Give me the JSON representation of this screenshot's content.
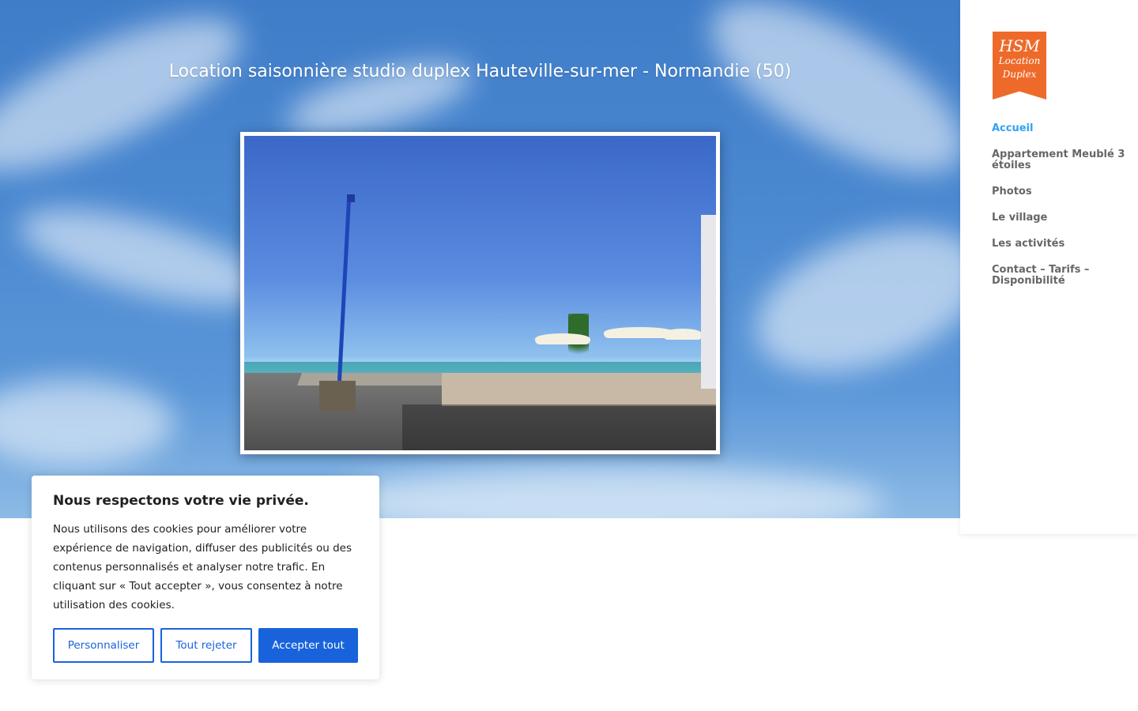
{
  "hero": {
    "title": "Location saisonnière studio duplex Hauteville-sur-mer - Normandie (50)"
  },
  "logo": {
    "line1": "HSM",
    "line2": "Location",
    "line3": "Duplex",
    "color": "#ee6a2a"
  },
  "nav": {
    "active_color": "#2ea3f2",
    "items": [
      {
        "label": "Accueil",
        "active": true
      },
      {
        "label": "Appartement Meublé 3 étoiles",
        "active": false
      },
      {
        "label": "Photos",
        "active": false
      },
      {
        "label": "Le village",
        "active": false
      },
      {
        "label": "Les activités",
        "active": false
      },
      {
        "label": "Contact – Tarifs – Disponibilité",
        "active": false
      }
    ]
  },
  "cookie": {
    "title": "Nous respectons votre vie privée.",
    "text": "Nous utilisons des cookies pour améliorer votre expérience de navigation, diffuser des publicités ou des contenus personnalisés et analyser notre trafic. En cliquant sur « Tout accepter », vous consentez à notre utilisation des cookies.",
    "customize_label": "Personnaliser",
    "reject_label": "Tout rejeter",
    "accept_label": "Accepter tout",
    "accent_color": "#1863dc"
  }
}
